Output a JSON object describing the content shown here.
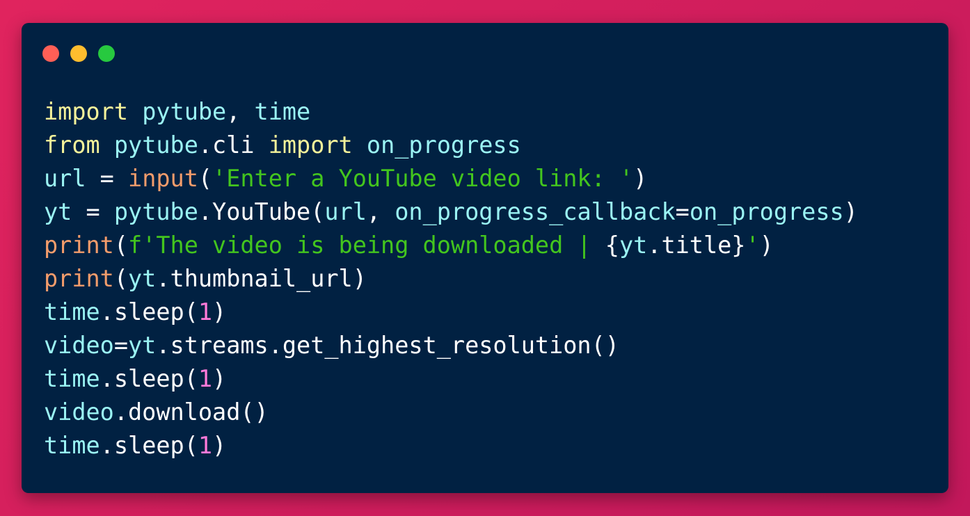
{
  "colors": {
    "background": "#d81b60",
    "window": "#012142",
    "close": "#ff5f56",
    "minimize": "#ffbd2e",
    "maximize": "#27c93f",
    "keyword": "#f5f29a",
    "module": "#9bf4f4",
    "plain": "#ffffff",
    "builtin": "#f39c6b",
    "string": "#43c51e",
    "number": "#ff7ad9"
  },
  "window_controls": [
    "close-button",
    "minimize-button",
    "maximize-button"
  ],
  "code": {
    "lines": [
      [
        [
          "keyword",
          "import"
        ],
        [
          "plain",
          " "
        ],
        [
          "module",
          "pytube"
        ],
        [
          "plain",
          ", "
        ],
        [
          "module",
          "time"
        ]
      ],
      [
        [
          "keyword",
          "from"
        ],
        [
          "plain",
          " "
        ],
        [
          "module",
          "pytube"
        ],
        [
          "plain",
          ".cli "
        ],
        [
          "keyword",
          "import"
        ],
        [
          "plain",
          " "
        ],
        [
          "module",
          "on_progress"
        ]
      ],
      [
        [
          "module",
          "url"
        ],
        [
          "plain",
          " = "
        ],
        [
          "builtin",
          "input"
        ],
        [
          "plain",
          "("
        ],
        [
          "string",
          "'Enter a YouTube video link: '"
        ],
        [
          "plain",
          ")"
        ]
      ],
      [
        [
          "module",
          "yt"
        ],
        [
          "plain",
          " = "
        ],
        [
          "module",
          "pytube"
        ],
        [
          "plain",
          ".YouTube("
        ],
        [
          "module",
          "url"
        ],
        [
          "plain",
          ", "
        ],
        [
          "module",
          "on_progress_callback"
        ],
        [
          "plain",
          "="
        ],
        [
          "module",
          "on_progress"
        ],
        [
          "plain",
          ")"
        ]
      ],
      [
        [
          "builtin",
          "print"
        ],
        [
          "plain",
          "("
        ],
        [
          "string",
          "f'The video is being downloaded | "
        ],
        [
          "plain",
          "{"
        ],
        [
          "module",
          "yt"
        ],
        [
          "plain",
          ".title}"
        ],
        [
          "string",
          "'"
        ],
        [
          "plain",
          ")"
        ]
      ],
      [
        [
          "builtin",
          "print"
        ],
        [
          "plain",
          "("
        ],
        [
          "module",
          "yt"
        ],
        [
          "plain",
          ".thumbnail_url)"
        ]
      ],
      [
        [
          "module",
          "time"
        ],
        [
          "plain",
          ".sleep("
        ],
        [
          "number",
          "1"
        ],
        [
          "plain",
          ")"
        ]
      ],
      [
        [
          "module",
          "video"
        ],
        [
          "plain",
          "="
        ],
        [
          "module",
          "yt"
        ],
        [
          "plain",
          ".streams.get_highest_resolution()"
        ]
      ],
      [
        [
          "module",
          "time"
        ],
        [
          "plain",
          ".sleep("
        ],
        [
          "number",
          "1"
        ],
        [
          "plain",
          ")"
        ]
      ],
      [
        [
          "module",
          "video"
        ],
        [
          "plain",
          ".download()"
        ]
      ],
      [
        [
          "module",
          "time"
        ],
        [
          "plain",
          ".sleep("
        ],
        [
          "number",
          "1"
        ],
        [
          "plain",
          ")"
        ]
      ]
    ]
  }
}
